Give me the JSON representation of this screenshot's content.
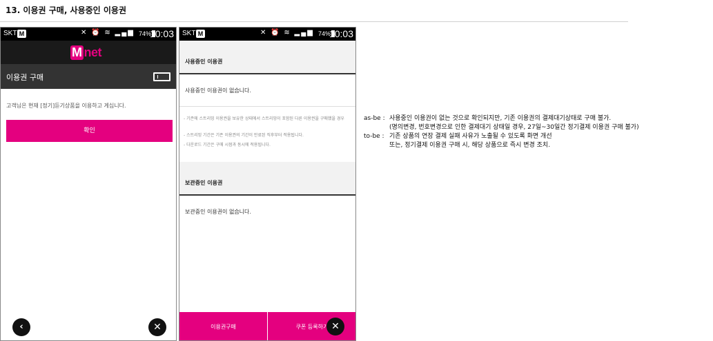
{
  "page": {
    "heading": "13. 이용권 구매, 사용중인 이용권"
  },
  "status_bar": {
    "carrier": "SKT",
    "carrier_badge": "M",
    "icons": "✕ ⏰ ≋ ▂▄▆",
    "battery": "74%",
    "time": "10:03"
  },
  "left_screen": {
    "logo_letter": "M",
    "logo_text": "net",
    "title": "이용권 구매",
    "notice": "고객님은 현재 [정기]듣기상품을 이용하고 게십니다.",
    "confirm_label": "확인",
    "back_symbol": "‹",
    "close_symbol": "✕"
  },
  "right_screen": {
    "in_use_heading": "사용중인 이용권",
    "in_use_empty": "사용중인 이용권이 없습니다.",
    "notes": [
      "- 기존에 스트리밍 이용권을 보유한 상태에서 스트리밍이 포함된 다른 이용권을 구매했을 경우",
      "- 스트리밍 기간은 기존 이용권의 기간이 만료된 직후부터 적용됩니다.",
      "- 다운로드 기간은 구매 시점과 동시에 적용됩니다."
    ],
    "stored_heading": "보관중인 이용권",
    "stored_empty": "보관중인 이용권이 없습니다.",
    "buy_button": "이용권구매",
    "coupon_button": "쿠폰 등록하기",
    "close_symbol": "✕"
  },
  "annotation": {
    "asbe_label": "as-be :",
    "asbe_line1": "사용중인 이용권이 없는 것으로 확인되지만, 기존 이용권의 결제대기상태로 구매 불가.",
    "asbe_line2": "(명의변경, 번호변경으로 인한 결제대기 상태일 경우, 27일~30일간 정기결제 이용권 구매 불가)",
    "tobe_label": "to-be :",
    "tobe_line1": "기존 상품의 연장 결제 실패 사유가 노출될 수 있도록 화면 개선",
    "tobe_line2": "또는, 정기결제 이용권 구매 시, 해당 상품으로 즉시 변경 조치."
  },
  "colors": {
    "accent": "#e4007f",
    "title_bar": "#333333",
    "status_bar": "#000000"
  }
}
